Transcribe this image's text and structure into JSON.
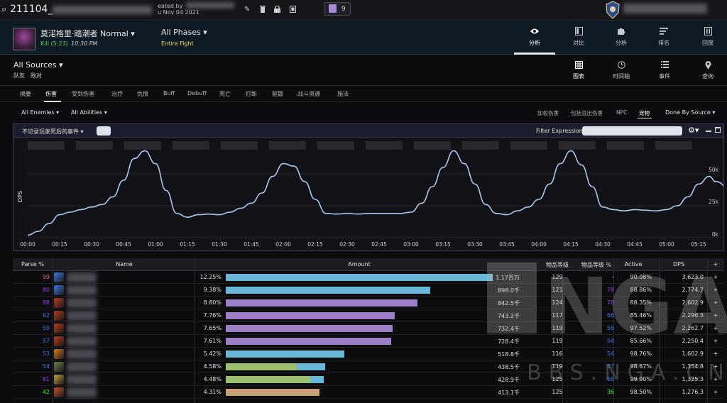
{
  "topbar": {
    "report_code": "211104_",
    "created_line1": "eated by",
    "created_line2": "u Nov 04 2021",
    "twitch_count": "9"
  },
  "fight": {
    "boss_name": "莫渃格里·踏潮者 Normal",
    "kill_label": "Kill (5:23)",
    "kill_time": "10:30 PM",
    "phase": "All Phases",
    "phase_sub": "Entire Fight"
  },
  "nav": [
    {
      "icon": "eye-icon",
      "label": "分析"
    },
    {
      "icon": "compare-icon",
      "label": "对比"
    },
    {
      "icon": "puzzle-icon",
      "label": "分析"
    },
    {
      "icon": "ranking-icon",
      "label": "排名"
    },
    {
      "icon": "replay-icon",
      "label": "回放"
    }
  ],
  "source": {
    "title": "All Sources",
    "friendly": "队友",
    "enemy": "敌对"
  },
  "views": [
    {
      "icon": "grid-icon",
      "label": "图表"
    },
    {
      "icon": "clock-icon",
      "label": "时间轴"
    },
    {
      "icon": "list-icon",
      "label": "事件"
    },
    {
      "icon": "pin-icon",
      "label": "查询"
    }
  ],
  "categories": [
    "摘要",
    "伤害",
    "受到伤害",
    "治疗",
    "仇恨",
    "Buff",
    "Debuff",
    "死亡",
    "打断",
    "驱散",
    "战斗资源",
    "施法"
  ],
  "filters": {
    "enemies": "All Enemies",
    "abilities": "All Abilities",
    "options": [
      "加权伤害",
      "包括溢出伤害",
      "NPC",
      "宠物"
    ],
    "done_by": "Done By Source"
  },
  "chart_header": {
    "death_events": "不记录玩家死后的事件",
    "filter_label": "Filter Expression:"
  },
  "chart_data": {
    "type": "line",
    "ylabel": "DPS",
    "y_ticks": [
      "50k",
      "25k",
      "0k"
    ],
    "ylim": [
      0,
      75000
    ],
    "x_ticks": [
      "00:00",
      "00:15",
      "00:30",
      "00:45",
      "01:00",
      "01:15",
      "01:30",
      "01:45",
      "02:00",
      "02:15",
      "02:30",
      "02:45",
      "03:00",
      "03:15",
      "03:30",
      "03:45",
      "04:00",
      "04:15",
      "04:30",
      "04:45",
      "05:00",
      "05:15"
    ],
    "x": [
      0,
      5,
      10,
      15,
      20,
      25,
      30,
      35,
      40,
      45,
      50,
      55,
      60,
      65,
      70,
      75,
      80,
      85,
      90,
      95,
      100,
      105,
      110,
      115,
      120,
      125,
      130,
      135,
      140,
      145,
      150,
      155,
      160,
      165,
      170,
      175,
      180,
      185,
      190,
      195,
      200,
      205,
      210,
      215,
      220,
      225,
      230,
      235,
      240,
      245,
      250,
      255,
      260,
      265,
      270,
      275,
      280,
      285,
      290,
      295,
      300,
      305,
      310,
      315,
      320,
      323
    ],
    "values": [
      2000,
      5000,
      11000,
      18000,
      20000,
      22000,
      24000,
      26000,
      32000,
      45000,
      62000,
      68000,
      58000,
      37000,
      19000,
      16000,
      18000,
      18500,
      18000,
      20000,
      23000,
      27000,
      35000,
      48000,
      58000,
      56000,
      44000,
      30000,
      19000,
      18500,
      19000,
      18500,
      19000,
      19000,
      19000,
      19000,
      20000,
      27000,
      40000,
      55000,
      68000,
      58000,
      42000,
      26000,
      19000,
      18000,
      21000,
      24000,
      30000,
      42000,
      58000,
      68000,
      57000,
      40000,
      24000,
      22000,
      21000,
      22000,
      21500,
      21000,
      22000,
      25000,
      32000,
      42000,
      48000,
      44000,
      38000,
      28000
    ],
    "series_color": "#a8c8f0"
  },
  "table": {
    "headers": [
      "Parse %",
      "Name",
      "Amount",
      "物品等级",
      "物品等级 %",
      "Active",
      "DPS",
      "+"
    ],
    "rows": [
      {
        "parse": "99",
        "parse_color": "#e268a8",
        "icon_color": "#3a7be0",
        "pct": "12.25%",
        "bar": 1.0,
        "bar_color": "#6ab8d8",
        "bar2": 0,
        "bar2_color": "",
        "amount": "1.17百万",
        "ilvl": "129",
        "ilvl_pct": "-",
        "ilvl_pct_color": "#cfcfcf",
        "active": "90.08%",
        "dps": "3,623.0"
      },
      {
        "parse": "80",
        "parse_color": "#a335ee",
        "icon_color": "#3a7be0",
        "pct": "9.38%",
        "bar": 0.766,
        "bar_color": "#6ab8d8",
        "bar2": 0,
        "bar2_color": "",
        "amount": "898.0千",
        "ilvl": "121",
        "ilvl_pct": "78",
        "ilvl_pct_color": "#a335ee",
        "active": "88.86%",
        "dps": "2,774.7"
      },
      {
        "parse": "88",
        "parse_color": "#a335ee",
        "icon_color": "#b04020",
        "pct": "8.80%",
        "bar": 0.719,
        "bar_color": "#9d7fc8",
        "bar2": 0,
        "bar2_color": "",
        "amount": "842.5千",
        "ilvl": "124",
        "ilvl_pct": "78",
        "ilvl_pct_color": "#a335ee",
        "active": "88.35%",
        "dps": "2,602.9"
      },
      {
        "parse": "62",
        "parse_color": "#3a78e8",
        "icon_color": "#b04020",
        "pct": "7.76%",
        "bar": 0.634,
        "bar_color": "#9d7fc8",
        "bar2": 0,
        "bar2_color": "",
        "amount": "743.2千",
        "ilvl": "117",
        "ilvl_pct": "66",
        "ilvl_pct_color": "#3a78e8",
        "active": "85.46%",
        "dps": "2,296.3"
      },
      {
        "parse": "59",
        "parse_color": "#3a78e8",
        "icon_color": "#b04020",
        "pct": "7.65%",
        "bar": 0.625,
        "bar_color": "#9d7fc8",
        "bar2": 0,
        "bar2_color": "",
        "amount": "732.4千",
        "ilvl": "119",
        "ilvl_pct": "56",
        "ilvl_pct_color": "#3a78e8",
        "active": "97.52%",
        "dps": "2,262.7"
      },
      {
        "parse": "57",
        "parse_color": "#3a78e8",
        "icon_color": "#b04020",
        "pct": "7.61%",
        "bar": 0.621,
        "bar_color": "#9d7fc8",
        "bar2": 0,
        "bar2_color": "",
        "amount": "728.4千",
        "ilvl": "119",
        "ilvl_pct": "54",
        "ilvl_pct_color": "#3a78e8",
        "active": "85.66%",
        "dps": "2,250.4"
      },
      {
        "parse": "53",
        "parse_color": "#3a78e8",
        "icon_color": "#d08020",
        "pct": "5.42%",
        "bar": 0.443,
        "bar_color": "#6ab8d8",
        "bar2": 0,
        "bar2_color": "",
        "amount": "518.8千",
        "ilvl": "116",
        "ilvl_pct": "54",
        "ilvl_pct_color": "#3a78e8",
        "active": "98.76%",
        "dps": "1,602.9"
      },
      {
        "parse": "54",
        "parse_color": "#3a78e8",
        "icon_color": "#6a8050",
        "pct": "4.58%",
        "bar": 0.267,
        "bar_color": "#9ac070",
        "bar2": 0.107,
        "bar2_color": "#6ab8d8",
        "amount": "438.5千",
        "ilvl": "119",
        "ilvl_pct": "57",
        "ilvl_pct_color": "#3a78e8",
        "active": "98.67%",
        "dps": "1,354.8"
      },
      {
        "parse": "81",
        "parse_color": "#a335ee",
        "icon_color": "#c0a040",
        "pct": "4.48%",
        "bar": 0.316,
        "bar_color": "#9ac070",
        "bar2": 0.05,
        "bar2_color": "#6ab8d8",
        "amount": "428.9千",
        "ilvl": "125",
        "ilvl_pct": "68",
        "ilvl_pct_color": "#3a78e8",
        "active": "99.90%",
        "dps": "1,325.3"
      },
      {
        "parse": "42",
        "parse_color": "#1eff00",
        "icon_color": "#c05030",
        "pct": "4.31%",
        "bar": 0.352,
        "bar_color": "#c8a078",
        "bar2": 0,
        "bar2_color": "",
        "amount": "413.1千",
        "ilvl": "125",
        "ilvl_pct": "36",
        "ilvl_pct_color": "#1eff00",
        "active": "98.50%",
        "dps": "1,276.3"
      }
    ]
  },
  "watermark": "NGA",
  "watermark_url": "BBS.NGA.CN"
}
